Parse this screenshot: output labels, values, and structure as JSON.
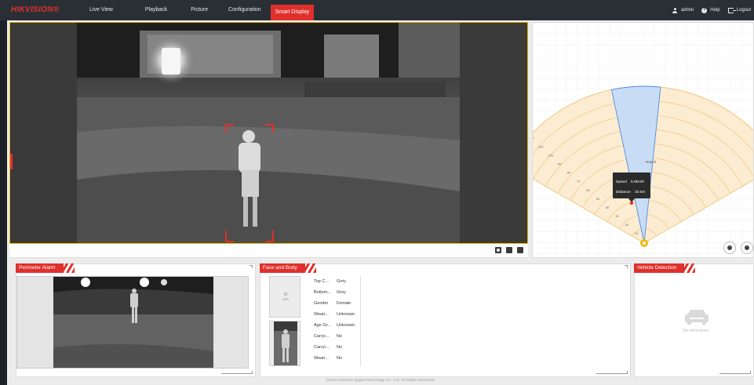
{
  "header": {
    "logo": "HIKVISION®",
    "nav": [
      "Live View",
      "Playback",
      "Picture",
      "Configuration",
      "Smart Display"
    ],
    "active_nav": "Smart Display",
    "user": "admin",
    "help": "Help",
    "logout": "Logout"
  },
  "radar": {
    "range_labels": [
      "100",
      "110",
      "100",
      "90",
      "80",
      "70",
      "60",
      "50",
      "40",
      "30",
      "20",
      "10"
    ],
    "target_label": "Report",
    "tooltip": {
      "speed_label": "Speed",
      "speed_value": "5.0km/h",
      "distance_label": "Distance",
      "distance_value": "33.0m"
    },
    "colors": {
      "fan": "#fbecd2",
      "fan_line": "#f0c070",
      "beam": "#c9dcf5",
      "beam_line": "#4f8de0",
      "target": "#e0302c"
    }
  },
  "panels": {
    "perimeter": {
      "title": "Perimeter Alarm"
    },
    "face_body": {
      "title": "Face and Body",
      "attributes": [
        {
          "key": "Top C...",
          "value": "Grey"
        },
        {
          "key": "Bottom...",
          "value": "Grey"
        },
        {
          "key": "Gender",
          "value": "Female"
        },
        {
          "key": "Weari...",
          "value": "Unknown"
        },
        {
          "key": "Age Gr...",
          "value": "Unknown"
        },
        {
          "key": "Carryi...",
          "value": "No"
        },
        {
          "key": "Carryi...",
          "value": "No"
        },
        {
          "key": "Weari...",
          "value": "No"
        }
      ]
    },
    "vehicle": {
      "title": "Vehicle Detection",
      "empty_text": "No information"
    }
  },
  "footer": "©2020 Hikvision Digital Technology Co., Ltd. All Rights Reserved.",
  "accent_color": "#e0302c"
}
